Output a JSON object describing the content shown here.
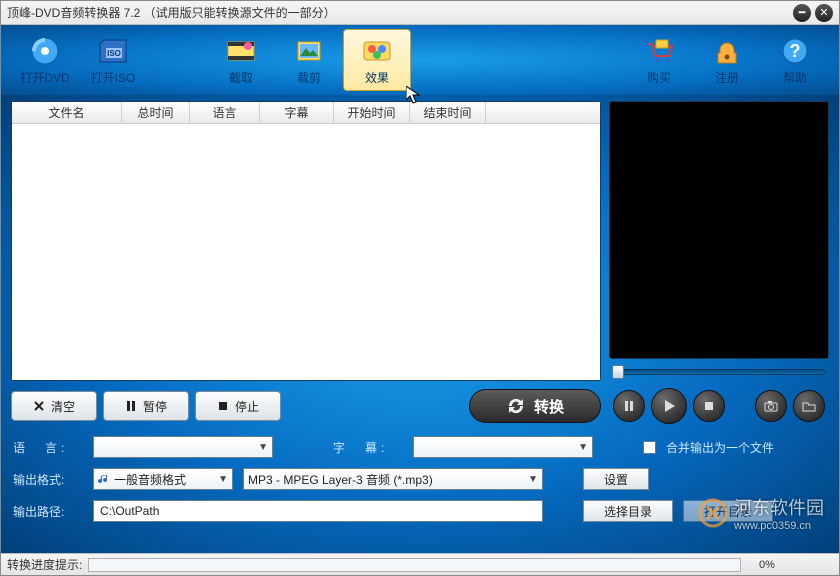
{
  "title": "顶峰-DVD音频转换器 7.2 （试用版只能转换源文件的一部分）",
  "toolbar": {
    "open_dvd": "打开DVD",
    "open_iso": "打开ISO",
    "capture": "截取",
    "crop": "裁剪",
    "effect": "效果",
    "buy": "购买",
    "register": "注册",
    "help": "帮助"
  },
  "columns": {
    "filename": "文件名",
    "total_time": "总时间",
    "language": "语言",
    "subtitle": "字幕",
    "start_time": "开始时间",
    "end_time": "结束时间"
  },
  "buttons": {
    "clear": "清空",
    "pause": "暂停",
    "stop": "停止",
    "convert": "转换",
    "settings": "设置",
    "choose_dir": "选择目录",
    "open_dir": "打开目录"
  },
  "labels": {
    "language": "语　言:",
    "subtitle": "字　幕:",
    "output_format": "输出格式:",
    "output_path": "输出路径:",
    "merge": "合并输出为一个文件",
    "progress": "转换进度提示:"
  },
  "values": {
    "format_group": "一般音频格式",
    "format": "MP3 - MPEG Layer-3 音频 (*.mp3)",
    "out_path": "C:\\OutPath",
    "progress_pct": "0%",
    "language_sel": "",
    "subtitle_sel": ""
  },
  "watermark": {
    "name": "河东软件园",
    "url": "www.pc0359.cn"
  }
}
